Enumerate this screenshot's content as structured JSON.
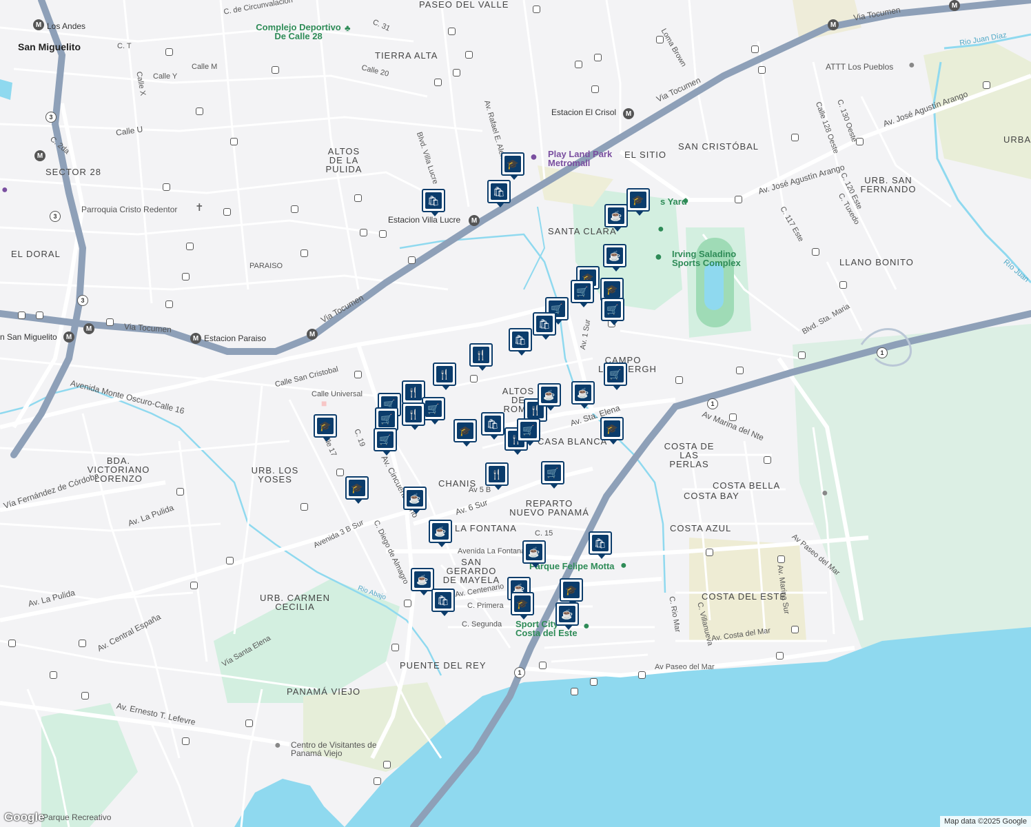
{
  "colors": {
    "land": "#f3f3f5",
    "water": "#8fd9ef",
    "park": "#d3efe0",
    "road": "#ffffff",
    "highway": "#8ea0b8",
    "pin": "#0b3c6b"
  },
  "neighborhoods": [
    "PASEO DEL VALLE",
    "TIERRA ALTA",
    "ALTOS DE LA PULIDA",
    "SECTOR 28",
    "EL DORAL",
    "PARAISO",
    "EL SITIO",
    "SAN CRISTÓBAL",
    "SANTA CLARA",
    "URB. SAN FERNANDO",
    "LLANO BONITO",
    "URBAN",
    "CAMPO LINDBERGH",
    "ALTOS DE ROMA",
    "CASA BLANCA",
    "COSTA DE LAS PERLAS",
    "COSTA BELLA",
    "COSTA BAY",
    "CHANIS",
    "REPARTO NUEVO PANAMÁ",
    "LA FONTANA",
    "COSTA AZUL",
    "SAN GERARDO DE MAYELA",
    "COSTA DEL ESTE",
    "URB. CARMEN CECILIA",
    "PUENTE DEL REY",
    "PANAMÁ VIEJO",
    "BDA. VICTORIANO LORENZO",
    "URB. LOS YOSES",
    "San Miguelito",
    "Los Andes"
  ],
  "pois": {
    "complejo": "Complejo Deportivo De Calle 28",
    "parroquia": "Parroquia Cristo Redentor",
    "playland": "Play Land Park Metromall",
    "yard": "s Yard",
    "irving": "Irving Saladino Sports Complex",
    "attt": "ATTT Los Pueblos",
    "felipe": "Parque Felipe Motta",
    "sport": "Sport City Costa del Este",
    "visitantes": "Centro de Visitantes de Panamá Viejo",
    "parque": "Parque Recreativo",
    "rio_juan": "Rio Juan Díaz",
    "rio_juan2": "Río Juan",
    "rio_abajo": "Rio Abajo"
  },
  "stations": {
    "crisol": "Estacion El Crisol",
    "lucre": "Estacion Villa Lucre",
    "paraiso": "Estacion Paraiso",
    "sanmig": "n San Miguelito"
  },
  "streets": {
    "tocumen1": "Via Tocumen",
    "tocumen2": "Via Tocumen",
    "tocumen3": "Via Tocumen",
    "tocumen4": "Via Tocumen",
    "arango1": "Av. José Agustín Arango",
    "arango2": "Av. José Agustín Arango",
    "cincuentenario": "Av. Cincuentenario",
    "centenario": "Av. Centenario",
    "primera": "C. Primera",
    "segunda": "C. Segunda",
    "fontana": "Avenida La Fontana",
    "sta_elena": "Av. Sta. Elena",
    "sur6": "Av. 6 Sur",
    "sur5": "Av 5 B",
    "marina": "Av Marina del Nte",
    "paseo_mar1": "Av Paseo del Mar",
    "paseo_mar2": "Av Paseo del Mar",
    "costa_mar": "Av. Costa del Mar",
    "pulida1": "Av. La Pulida",
    "pulida2": "Av. La Pulida",
    "espana": "Av. Central España",
    "lefevre": "Av. Ernesto T. Lefevre",
    "oscuro": "Avenida Monte Oscuro-Calle 16",
    "cordoba": "Vía Fernández de Córdoba",
    "sta_maria": "Blvd. Sta. Maria",
    "universal": "Calle Universal",
    "cristobal": "Calle San Cristobal",
    "circun": "C. de Circunvalacion",
    "villa_lucre": "Blvd. Villa Lucre",
    "rafael": "Av. Rafael E. Alemán",
    "sur1": "Av. 1 Sur",
    "este117": "C. 117 Este",
    "oeste130": "C. 130 Oeste",
    "oeste128": "Calle 128 Oeste",
    "tuxedo": "C. Tuxedo",
    "este120": "C. 120 Este",
    "loma": "Loma Brown",
    "rio_mar": "C. Rio Mar",
    "villanueva": "C. Villanueva",
    "marina_sur": "Av. Marina Sur",
    "diego": "C. Diego de Almagro",
    "sur3b": "Avenida 3 B Sur",
    "c15": "C. 15",
    "santa_elena_via": "Vía Santa Elena",
    "calle17": "Calle 17",
    "c19": "C. 19",
    "calle_t": "C. T",
    "calle_u": "Calle U",
    "c2da": "C. 2da",
    "calle_m": "Calle M",
    "calle_y": "Calle Y",
    "c31": "C. 31",
    "calle20": "Calle 20",
    "calle_x": "Calle X"
  },
  "shields": {
    "r3a": "3",
    "r3b": "3",
    "r3c": "3",
    "r1a": "1",
    "r1b": "1",
    "r1c": "1"
  },
  "markers": [
    {
      "icon": "school-icon",
      "glyph": "🎓"
    },
    {
      "icon": "bag-icon",
      "glyph": "🛍"
    },
    {
      "icon": "bag-icon",
      "glyph": "🛍"
    },
    {
      "icon": "school-icon",
      "glyph": "🎓"
    },
    {
      "icon": "cafe-icon",
      "glyph": "☕"
    },
    {
      "icon": "cafe-icon",
      "glyph": "☕"
    },
    {
      "icon": "school-icon",
      "glyph": "🎓"
    },
    {
      "icon": "cart-icon",
      "glyph": "🛒"
    },
    {
      "icon": "school-icon",
      "glyph": "🎓"
    },
    {
      "icon": "cart-icon",
      "glyph": "🛒"
    },
    {
      "icon": "cart-icon",
      "glyph": "🛒"
    },
    {
      "icon": "bag-icon",
      "glyph": "🛍"
    },
    {
      "icon": "bag-icon",
      "glyph": "🛍"
    },
    {
      "icon": "restaurant-icon",
      "glyph": "🍴"
    },
    {
      "icon": "restaurant-icon",
      "glyph": "🍴"
    },
    {
      "icon": "cart-icon",
      "glyph": "🛒"
    },
    {
      "icon": "restaurant-icon",
      "glyph": "🍴"
    },
    {
      "icon": "cart-icon",
      "glyph": "🛒"
    },
    {
      "icon": "cart-icon",
      "glyph": "🛒"
    },
    {
      "icon": "restaurant-icon",
      "glyph": "🍴"
    },
    {
      "icon": "cart-icon",
      "glyph": "🛒"
    },
    {
      "icon": "cart-icon",
      "glyph": "🛒"
    },
    {
      "icon": "school-icon",
      "glyph": "🎓"
    },
    {
      "icon": "bag-icon",
      "glyph": "🛍"
    },
    {
      "icon": "restaurant-icon",
      "glyph": "🍴"
    },
    {
      "icon": "restaurant-icon",
      "glyph": "🍴"
    },
    {
      "icon": "cart-icon",
      "glyph": "🛒"
    },
    {
      "icon": "cafe-icon",
      "glyph": "☕"
    },
    {
      "icon": "cafe-icon",
      "glyph": "☕"
    },
    {
      "icon": "school-icon",
      "glyph": "🎓"
    },
    {
      "icon": "school-icon",
      "glyph": "🎓"
    },
    {
      "icon": "cafe-icon",
      "glyph": "☕"
    },
    {
      "icon": "restaurant-icon",
      "glyph": "🍴"
    },
    {
      "icon": "cart-icon",
      "glyph": "🛒"
    },
    {
      "icon": "cafe-icon",
      "glyph": "☕"
    },
    {
      "icon": "cafe-icon",
      "glyph": "☕"
    },
    {
      "icon": "bag-icon",
      "glyph": "🛍"
    },
    {
      "icon": "cafe-icon",
      "glyph": "☕"
    },
    {
      "icon": "bag-icon",
      "glyph": "🛍"
    },
    {
      "icon": "cafe-icon",
      "glyph": "☕"
    },
    {
      "icon": "school-icon",
      "glyph": "🎓"
    },
    {
      "icon": "school-icon",
      "glyph": "🎓"
    },
    {
      "icon": "cafe-icon",
      "glyph": "☕"
    },
    {
      "icon": "school-icon",
      "glyph": "🎓"
    }
  ],
  "logo": "Google",
  "attribution": "Map data ©2025 Google"
}
